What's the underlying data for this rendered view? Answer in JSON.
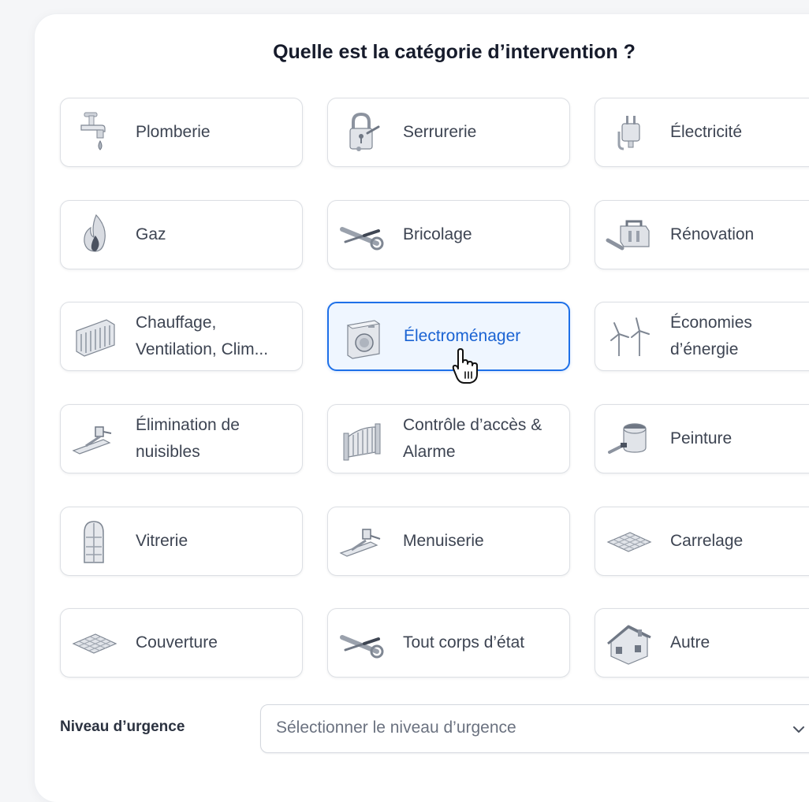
{
  "page": {
    "title": "Quelle est la catégorie d’intervention ?"
  },
  "categories": [
    {
      "label": "Plomberie",
      "icon": "faucet-icon"
    },
    {
      "label": "Serrurerie",
      "icon": "padlock-icon"
    },
    {
      "label": "Électricité",
      "icon": "plug-icon"
    },
    {
      "label": "Gaz",
      "icon": "flame-icon"
    },
    {
      "label": "Bricolage",
      "icon": "tools-icon"
    },
    {
      "label": "Rénovation",
      "icon": "toolbox-icon"
    },
    {
      "label": "Chauffage,\nVentilation, Clim...",
      "icon": "radiator-icon"
    },
    {
      "label": "Électroménager",
      "icon": "washing-machine-icon",
      "selected": true
    },
    {
      "label": "Économies\nd’énergie",
      "icon": "wind-turbine-icon"
    },
    {
      "label": "Élimination de\nnuisibles",
      "icon": "pest-trap-icon"
    },
    {
      "label": "Contrôle d’accès &\nAlarme",
      "icon": "gate-icon"
    },
    {
      "label": "Peinture",
      "icon": "paint-bucket-icon"
    },
    {
      "label": "Vitrerie",
      "icon": "window-icon"
    },
    {
      "label": "Menuiserie",
      "icon": "hammer-icon"
    },
    {
      "label": "Carrelage",
      "icon": "tiles-icon"
    },
    {
      "label": "Couverture",
      "icon": "roof-tiles-icon"
    },
    {
      "label": "Tout corps d’état",
      "icon": "tools-icon"
    },
    {
      "label": "Autre",
      "icon": "house-icon"
    }
  ],
  "urgency": {
    "label": "Niveau d’urgence",
    "placeholder": "Sélectionner le niveau d’urgence"
  },
  "colors": {
    "accent": "#1e70e8",
    "selected_bg": "#eff6ff",
    "border": "#dcdfe4",
    "text": "#3d4452",
    "title": "#161b2b"
  }
}
